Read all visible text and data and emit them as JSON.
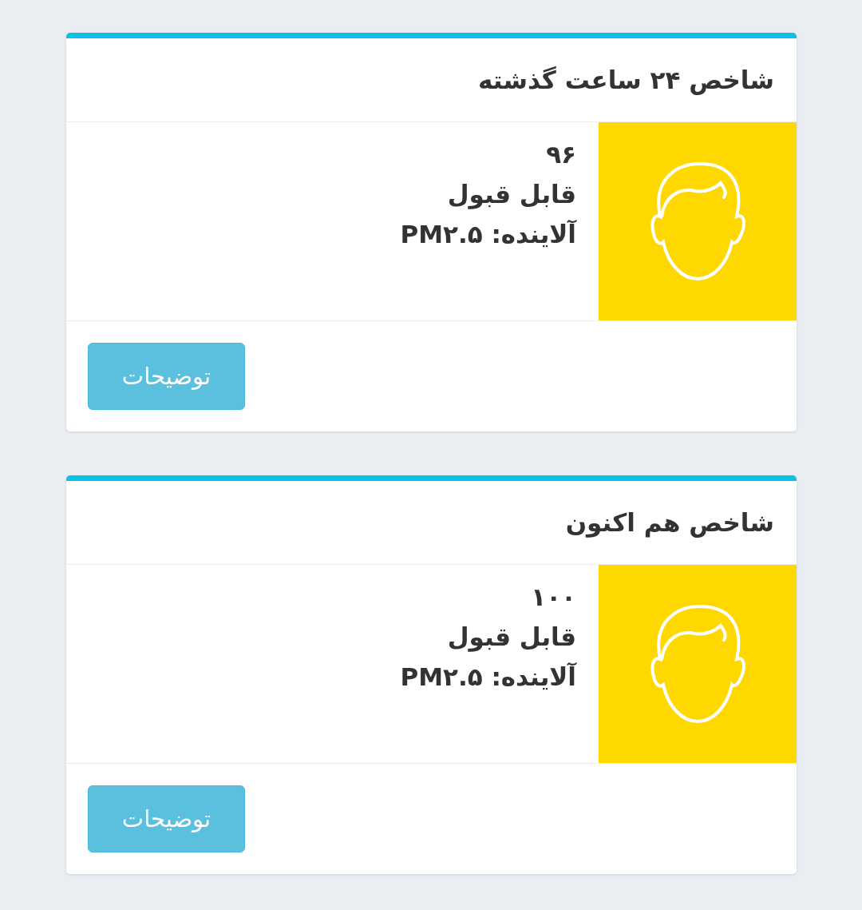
{
  "cards": [
    {
      "title": "شاخص ۲۴ ساعت گذشته",
      "value": "۹۶",
      "status": "قابل قبول",
      "pollutant": "آلاینده: PM۲.۵",
      "color": "#ffd800",
      "button": "توضیحات"
    },
    {
      "title": "شاخص هم اکنون",
      "value": "۱۰۰",
      "status": "قابل قبول",
      "pollutant": "آلاینده: PM۲.۵",
      "color": "#ffd800",
      "button": "توضیحات"
    }
  ]
}
